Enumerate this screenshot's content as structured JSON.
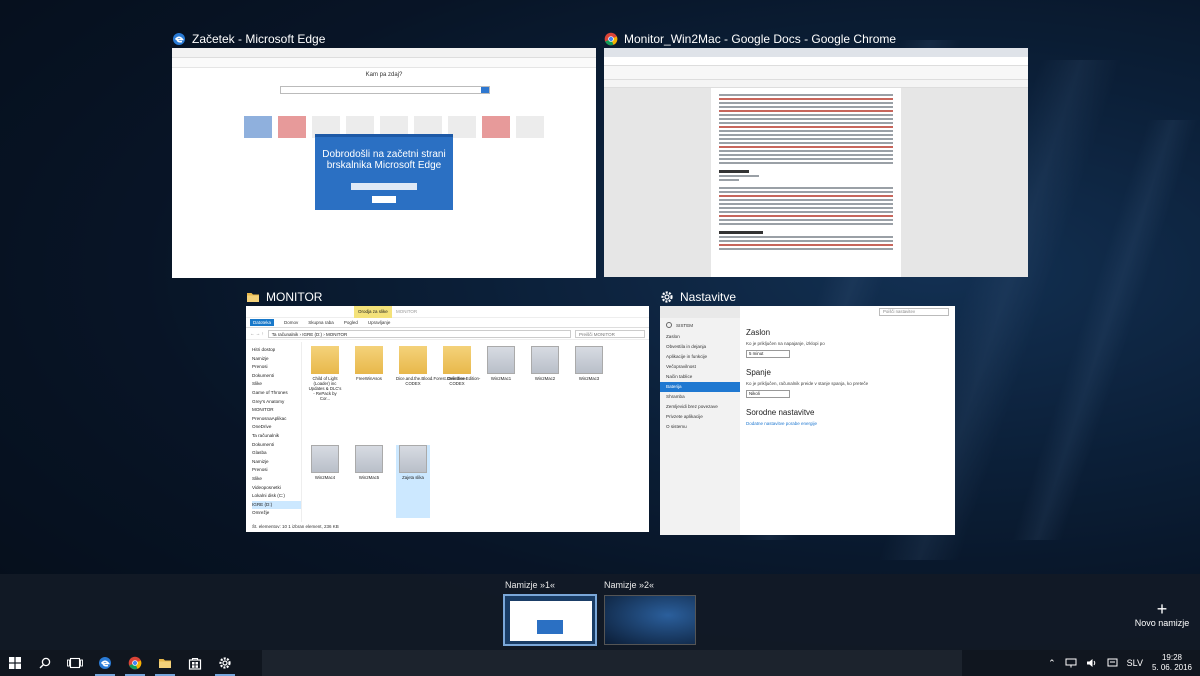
{
  "windows": {
    "edge": {
      "title": "Začetek - Microsoft Edge",
      "prompt": "Kam pa zdaj?",
      "dialog_title": "Dobrodošli na začetni strani brskalnika Microsoft Edge"
    },
    "chrome": {
      "title": "Monitor_Win2Mac - Google Docs - Google Chrome"
    },
    "explorer": {
      "title": "MONITOR",
      "ribbon": [
        "Datoteka",
        "Domov",
        "Skupna raba",
        "Pogled"
      ],
      "ribbon_context": "Orodja za slike",
      "ribbon_context_tab": "Upravljanje",
      "path": "Ta računalnik › IGRE (D:) › MONITOR",
      "search_placeholder": "Preišči MONITOR",
      "nav": [
        "Hitri dostop",
        "Namizje",
        "Prenosi",
        "Dokumenti",
        "Slike",
        "Game of Thrones",
        "Grey's Anatomy",
        "MONITOR",
        "PrenosnaAplikac",
        "OneDrive",
        "Ta računalnik",
        "Dokumenti",
        "Glasba",
        "Namizje",
        "Prenosi",
        "Slike",
        "Videoposnetki",
        "Lokalni disk (C:)",
        "IGRE (D:)",
        "Omrežje"
      ],
      "files": [
        {
          "name": "Child of Light (Loader) inc Updates & DLC's - RePack by Cor...",
          "kind": "folder"
        },
        {
          "name": "FreeWinAsos",
          "kind": "folder"
        },
        {
          "name": "Dice.and.the.Blood.Forest.Definitive.Edition-CODEX",
          "kind": "folder"
        },
        {
          "name": "Overthee-CODEX",
          "kind": "folder"
        },
        {
          "name": "Win2Mac1",
          "kind": "image"
        },
        {
          "name": "Win2Mac2",
          "kind": "image"
        },
        {
          "name": "Win2Mac3",
          "kind": "image"
        },
        {
          "name": "Win2Mac4",
          "kind": "image"
        },
        {
          "name": "Win2Mac5",
          "kind": "image"
        },
        {
          "name": "Zajeta slika",
          "kind": "image"
        }
      ],
      "status": "Št. elementov: 10    1 izbran element, 236 KB"
    },
    "settings": {
      "title": "Nastavitve",
      "search_placeholder": "Poišči nastavitev",
      "home": "SISTEM",
      "menu": [
        "Zaslon",
        "Obvestila in dejanja",
        "Aplikacije in funkcije",
        "Večopravilnost",
        "Način tablice",
        "Baterija",
        "Shramba",
        "Zemljevidi brez povezave",
        "Privzete aplikacije",
        "O sistemu"
      ],
      "selected_menu_index": 5,
      "section1": "Zaslon",
      "section1_text": "Ko je priključen na napajanje, izklopi po",
      "section1_value": "5 minut",
      "section2": "Spanje",
      "section2_text": "Ko je priključen, računalnik preide v stanje spanja, ko preteče",
      "section2_value": "Nikoli",
      "section3": "Sorodne nastavitve",
      "section3_link": "Dodatne nastavitve porabe energije"
    }
  },
  "desktops": {
    "items": [
      "Namizje »1«",
      "Namizje »2«"
    ],
    "new_label": "Novo namizje"
  },
  "taskbar": {
    "language": "SLV",
    "time": "19:28",
    "date": "5. 06. 2016"
  },
  "colors": {
    "accent": "#1f78d1",
    "taskbar": "#10161f"
  }
}
